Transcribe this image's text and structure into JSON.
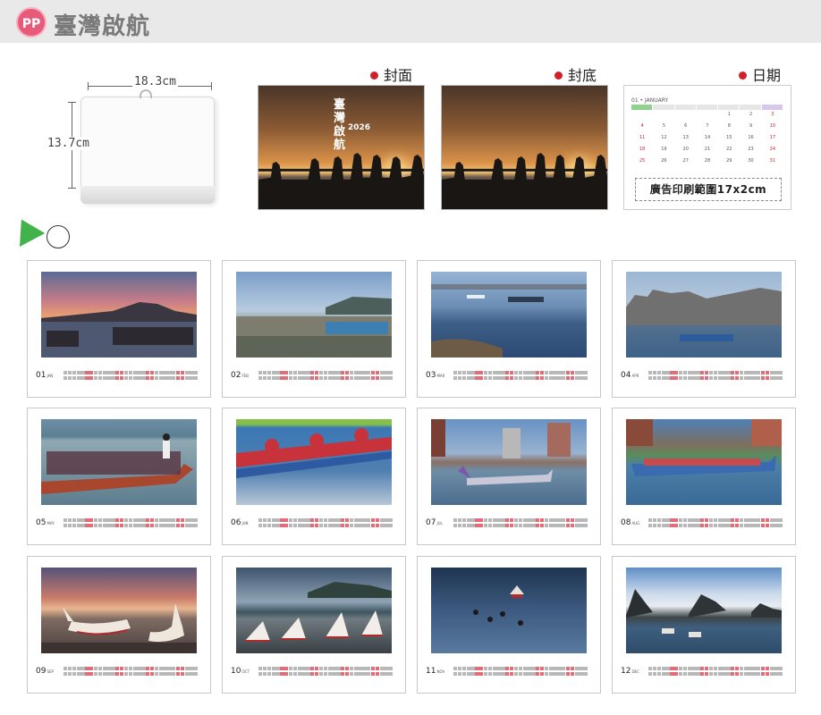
{
  "header": {
    "badge": "PP",
    "title": "臺灣啟航"
  },
  "product": {
    "width_label": "18.3cm",
    "height_label": "13.7cm"
  },
  "previews": {
    "cover_label": "封面",
    "back_label": "封底",
    "date_label": "日期",
    "cover_title": "臺灣啟航",
    "cover_year": "2026",
    "datepad_month": "01 • JANUARY",
    "datepad_ad": "廣告印刷範圍17x2cm"
  },
  "months": [
    {
      "num": "01",
      "abbr": "JAN"
    },
    {
      "num": "02",
      "abbr": "FEB"
    },
    {
      "num": "03",
      "abbr": "MAR"
    },
    {
      "num": "04",
      "abbr": "APR"
    },
    {
      "num": "05",
      "abbr": "MAY"
    },
    {
      "num": "06",
      "abbr": "JUN"
    },
    {
      "num": "07",
      "abbr": "JUL"
    },
    {
      "num": "08",
      "abbr": "AUG"
    },
    {
      "num": "09",
      "abbr": "SEP"
    },
    {
      "num": "10",
      "abbr": "OCT"
    },
    {
      "num": "11",
      "abbr": "NOV"
    },
    {
      "num": "12",
      "abbr": "DEC"
    }
  ],
  "colors": {
    "accent_red": "#d11f2b",
    "header_bg": "#e9e9e9",
    "badge_pink": "#e85a7a",
    "doodle_green": "#42b34b"
  },
  "icons": {
    "badge": "pp-logo-icon",
    "label_dot": "red-dot-icon",
    "doodle": "girl-doodle-icon"
  }
}
